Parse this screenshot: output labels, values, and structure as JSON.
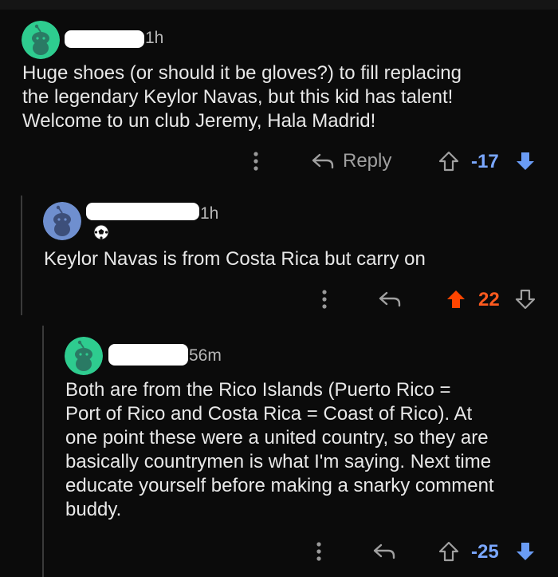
{
  "comments": [
    {
      "time": "1h",
      "text": "Huge shoes (or should it be gloves?) to fill replacing\nthe legendary Keylor Navas, but this kid has talent!\nWelcome to un club Jeremy, Hala Madrid!",
      "reply_label": "Reply",
      "score": "-17",
      "avatar_color": "#2ecc8f",
      "vote_state": "down"
    },
    {
      "time": "1h",
      "text": "Keylor Navas is from Costa Rica but carry on",
      "score": "22",
      "avatar_color": "#6f8fcf",
      "vote_state": "up",
      "flair_icon": "soccer-ball-icon"
    },
    {
      "time": "56m",
      "text": "Both are from the Rico Islands (Puerto Rico =\nPort of Rico and Costa Rica = Coast of Rico). At\none point these were a united country, so they are\nbasically countrymen is what I'm saying. Next time\neducate yourself before making a snarky comment\nbuddy.",
      "score": "-25",
      "avatar_color": "#2ecc8f",
      "vote_state": "down"
    }
  ],
  "colors": {
    "downvote": "#6a9cf5",
    "upvote": "#ff4500",
    "score_down": "#7aa7ff",
    "score_up": "#ff5a1f",
    "neutral_icon": "#a0a0a0"
  },
  "more_icon": "more-vertical-icon",
  "reply_icon": "reply-arrow-icon"
}
